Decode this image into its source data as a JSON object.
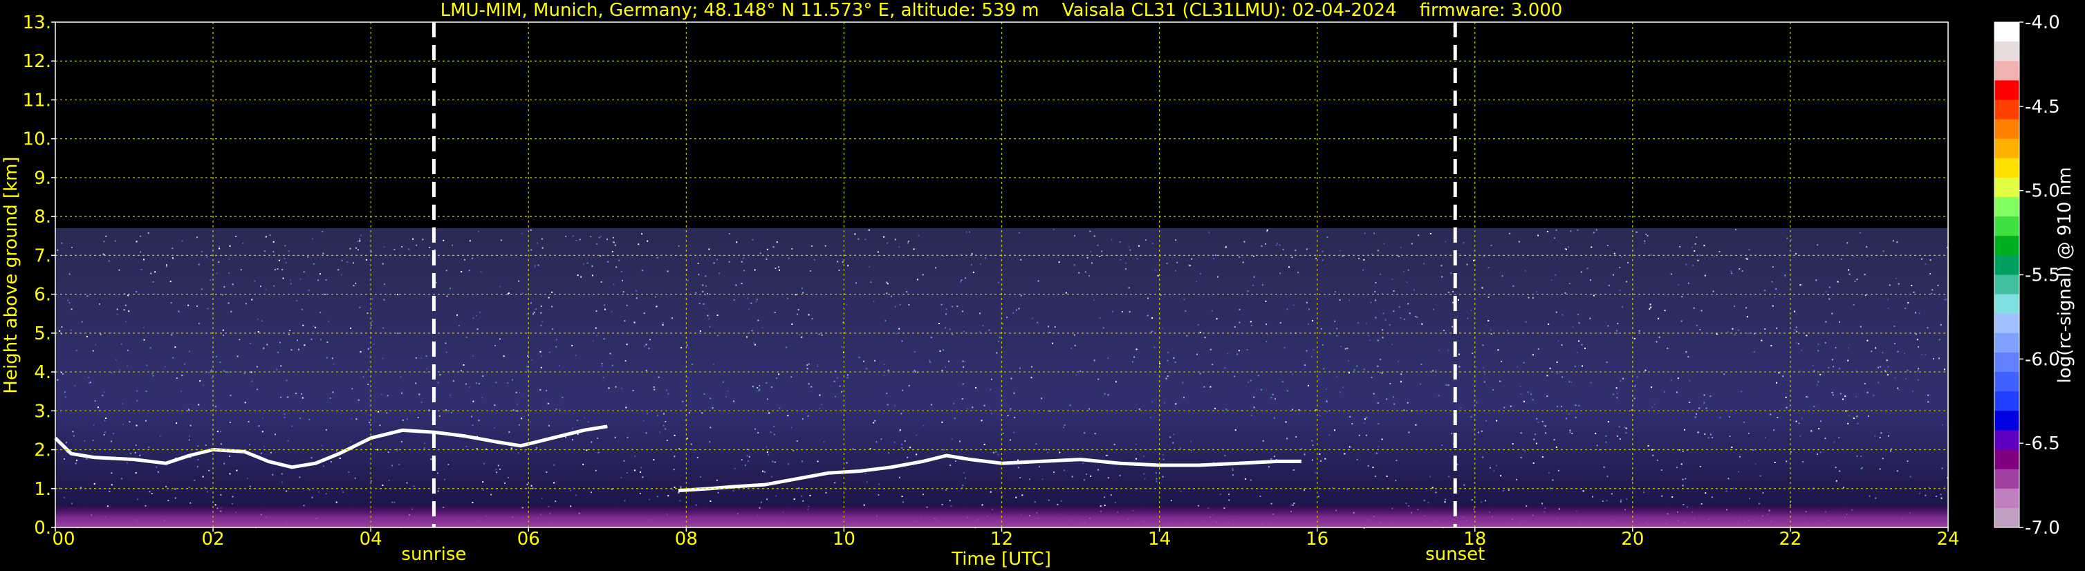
{
  "title": "LMU-MIM, Munich, Germany; 48.148° N 11.573° E, altitude: 539 m    Vaisala CL31 (CL31LMU): 02-04-2024    firmware: 3.000",
  "colors": {
    "axis_text": "#ffff00",
    "grid": "#c8c800",
    "background": "#000000",
    "event_line": "#ffffff"
  },
  "chart_data": {
    "type": "heatmap",
    "title": "LMU-MIM, Munich, Germany; 48.148° N 11.573° E, altitude: 539 m    Vaisala CL31 (CL31LMU): 02-04-2024    firmware: 3.000",
    "xlabel": "Time [UTC]",
    "ylabel": "Height above ground [km]",
    "xlim": [
      0,
      24
    ],
    "ylim": [
      0,
      13
    ],
    "x_ticks": [
      0,
      2,
      4,
      6,
      8,
      10,
      12,
      14,
      16,
      18,
      20,
      22,
      24
    ],
    "x_tick_labels": [
      "00",
      "02",
      "04",
      "06",
      "08",
      "10",
      "12",
      "14",
      "16",
      "18",
      "20",
      "22",
      "24"
    ],
    "y_ticks": [
      0,
      1,
      2,
      3,
      4,
      5,
      6,
      7,
      8,
      9,
      10,
      11,
      12,
      13
    ],
    "y_tick_labels": [
      "0.",
      "1.",
      "2.",
      "3.",
      "4.",
      "5.",
      "6.",
      "7.",
      "8.",
      "9.",
      "10.",
      "11.",
      "12.",
      "13."
    ],
    "grid": true,
    "signal_top_km": 7.7,
    "events": [
      {
        "label": "sunrise",
        "time_h": 4.8
      },
      {
        "label": "sunset",
        "time_h": 17.75
      }
    ],
    "cloud_layer": [
      [
        0.0,
        2.3
      ],
      [
        0.2,
        1.9
      ],
      [
        0.5,
        1.8
      ],
      [
        1.0,
        1.75
      ],
      [
        1.4,
        1.65
      ],
      [
        1.7,
        1.85
      ],
      [
        2.0,
        2.0
      ],
      [
        2.4,
        1.95
      ],
      [
        2.7,
        1.7
      ],
      [
        3.0,
        1.55
      ],
      [
        3.3,
        1.65
      ],
      [
        3.6,
        1.9
      ],
      [
        4.0,
        2.3
      ],
      [
        4.4,
        2.5
      ],
      [
        4.8,
        2.45
      ],
      [
        5.2,
        2.35
      ],
      [
        5.6,
        2.2
      ],
      [
        5.9,
        2.1
      ],
      [
        6.3,
        2.3
      ],
      [
        6.7,
        2.5
      ],
      [
        7.0,
        2.6
      ]
    ],
    "cloud_layer_2": [
      [
        7.9,
        0.95
      ],
      [
        8.3,
        1.0
      ],
      [
        8.6,
        1.05
      ],
      [
        9.0,
        1.1
      ],
      [
        9.4,
        1.25
      ],
      [
        9.8,
        1.4
      ],
      [
        10.2,
        1.45
      ],
      [
        10.6,
        1.55
      ],
      [
        11.0,
        1.7
      ],
      [
        11.3,
        1.85
      ],
      [
        11.6,
        1.75
      ],
      [
        12.0,
        1.65
      ],
      [
        12.5,
        1.7
      ],
      [
        13.0,
        1.75
      ],
      [
        13.5,
        1.65
      ],
      [
        14.0,
        1.6
      ],
      [
        14.5,
        1.6
      ],
      [
        15.0,
        1.65
      ],
      [
        15.5,
        1.7
      ],
      [
        15.8,
        1.7
      ]
    ],
    "colorbar": {
      "label": "log(rc-signal) @ 910 nm",
      "range": [
        -7.0,
        -4.0
      ],
      "tick_values": [
        -4.0,
        -4.5,
        -5.0,
        -5.5,
        -6.0,
        -6.5,
        -7.0
      ],
      "tick_labels": [
        "-4.0",
        "-4.5",
        "-5.0",
        "-5.5",
        "-6.0",
        "-6.5",
        "-7.0"
      ],
      "colors": [
        "#ffffff",
        "#e8dcdc",
        "#f2b2b2",
        "#ff0000",
        "#ff4000",
        "#ff8000",
        "#ffb000",
        "#ffe000",
        "#e0ff40",
        "#80ff60",
        "#40e040",
        "#00b020",
        "#00a060",
        "#40c0a0",
        "#80e0e0",
        "#a0c0ff",
        "#80a0ff",
        "#6080ff",
        "#4060ff",
        "#2040ff",
        "#0000e0",
        "#6000c0",
        "#800080",
        "#a040a0",
        "#c080c0",
        "#c0a0c0"
      ]
    }
  }
}
